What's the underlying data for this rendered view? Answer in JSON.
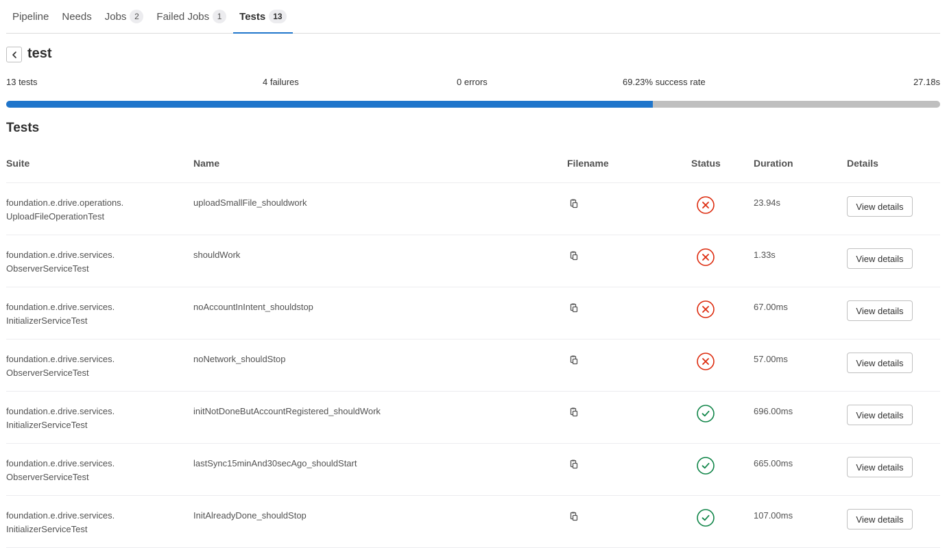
{
  "tabs": [
    {
      "label": "Pipeline",
      "badge": null
    },
    {
      "label": "Needs",
      "badge": null
    },
    {
      "label": "Jobs",
      "badge": "2"
    },
    {
      "label": "Failed Jobs",
      "badge": "1"
    },
    {
      "label": "Tests",
      "badge": "13",
      "active": true
    }
  ],
  "header": {
    "title": "test",
    "back_icon": "chevron-left-icon"
  },
  "summary": {
    "tests": "13 tests",
    "failures": "4 failures",
    "errors": "0 errors",
    "success_rate": "69.23% success rate",
    "duration": "27.18s",
    "success_fraction": 0.6923
  },
  "section": {
    "title": "Tests"
  },
  "table": {
    "headers": {
      "suite": "Suite",
      "name": "Name",
      "filename": "Filename",
      "status": "Status",
      "duration": "Duration",
      "details": "Details"
    },
    "rows": [
      {
        "suite1": "foundation.e.drive.operations.",
        "suite2": "UploadFileOperationTest",
        "name": "uploadSmallFile_shouldwork",
        "status": "failed",
        "duration": "23.94s",
        "action": "View details"
      },
      {
        "suite1": "foundation.e.drive.services.",
        "suite2": "ObserverServiceTest",
        "name": "shouldWork",
        "status": "failed",
        "duration": "1.33s",
        "action": "View details"
      },
      {
        "suite1": "foundation.e.drive.services.",
        "suite2": "InitializerServiceTest",
        "name": "noAccountInIntent_shouldstop",
        "status": "failed",
        "duration": "67.00ms",
        "action": "View details"
      },
      {
        "suite1": "foundation.e.drive.services.",
        "suite2": "ObserverServiceTest",
        "name": "noNetwork_shouldStop",
        "status": "failed",
        "duration": "57.00ms",
        "action": "View details"
      },
      {
        "suite1": "foundation.e.drive.services.",
        "suite2": "InitializerServiceTest",
        "name": "initNotDoneButAccountRegistered_shouldWork",
        "status": "success",
        "duration": "696.00ms",
        "action": "View details"
      },
      {
        "suite1": "foundation.e.drive.services.",
        "suite2": "ObserverServiceTest",
        "name": "lastSync15minAnd30secAgo_shouldStart",
        "status": "success",
        "duration": "665.00ms",
        "action": "View details"
      },
      {
        "suite1": "foundation.e.drive.services.",
        "suite2": "InitializerServiceTest",
        "name": "InitAlreadyDone_shouldStop",
        "status": "success",
        "duration": "107.00ms",
        "action": "View details"
      }
    ]
  },
  "colors": {
    "accent": "#1f75cb",
    "failed": "#dd2b0e",
    "success": "#108548",
    "progress_track": "#bfbfbf"
  },
  "icons": {
    "filename": "copy-to-clipboard-icon",
    "failed": "status-failed-icon",
    "success": "status-success-icon"
  }
}
